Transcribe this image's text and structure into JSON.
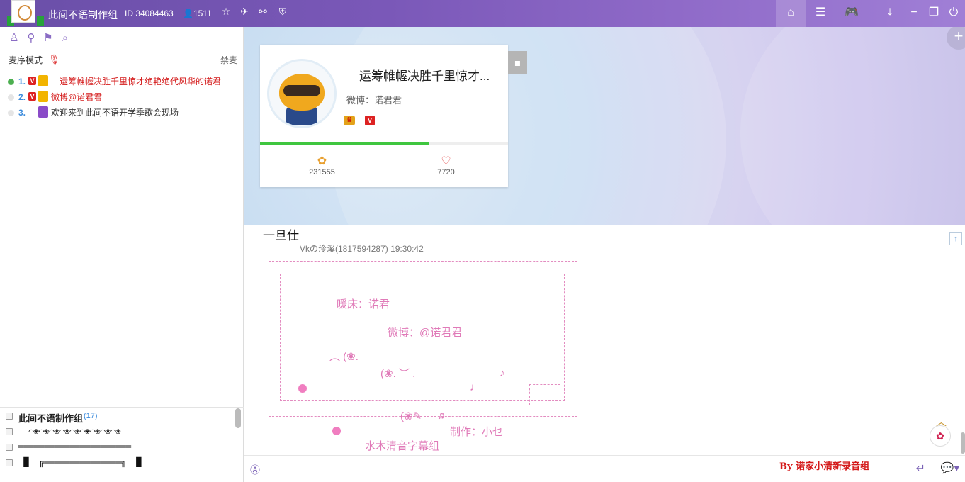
{
  "topbar": {
    "channel_name": "此间不语制作组",
    "room_id": "ID 34084463",
    "user_count": "1511",
    "icons": [
      "favorite-star-icon",
      "plane-icon",
      "share-icon",
      "shield-icon"
    ],
    "right_tools": [
      "home-icon",
      "list-icon",
      "gamepad-icon",
      "download-icon",
      "minimize-icon",
      "restore-icon",
      "power-icon"
    ]
  },
  "left_panel": {
    "tool_icons": [
      "user-icon",
      "location-icon",
      "flag-icon",
      "search-icon"
    ],
    "mic_mode_label": "麦序模式",
    "ban_label": "禁麦",
    "queue": [
      {
        "num": "1.",
        "text": "运筹帷幄决胜千里惊才绝艳绝代风华的诺君",
        "active": true
      },
      {
        "num": "2.",
        "text": "微博@诺君君",
        "active": false
      },
      {
        "num": "3.",
        "text": "欢迎来到此间不语开学季歌会现场",
        "active": false
      }
    ],
    "group": {
      "name": "此间不语制作组",
      "count": "(17)",
      "lines": [
        "  ⌒❀⌒❀⌒❀⌒❀⌒❀⌒❀⌒❀⌒❀⌒❀",
        "══════════════════════",
        " █  ╔═══════════════╗  █"
      ]
    }
  },
  "anchor_card": {
    "name": "运筹帷幄决胜千里惊才...",
    "weibo": "微博：诺君君",
    "flowers": "231555",
    "likes": "7720",
    "progress": 0.68
  },
  "chat": {
    "title": "一旦仕",
    "sender": "Vkの泠溪(1817594287) 19:30:42",
    "art_lines": {
      "line1": "暖床：诺君",
      "line2": "微博：@诺君君",
      "line3": "制作：小乜",
      "line4": "水木清音字幕组"
    }
  },
  "input": {
    "placeholder": "",
    "signature": "By 诺家小清新录音组"
  }
}
